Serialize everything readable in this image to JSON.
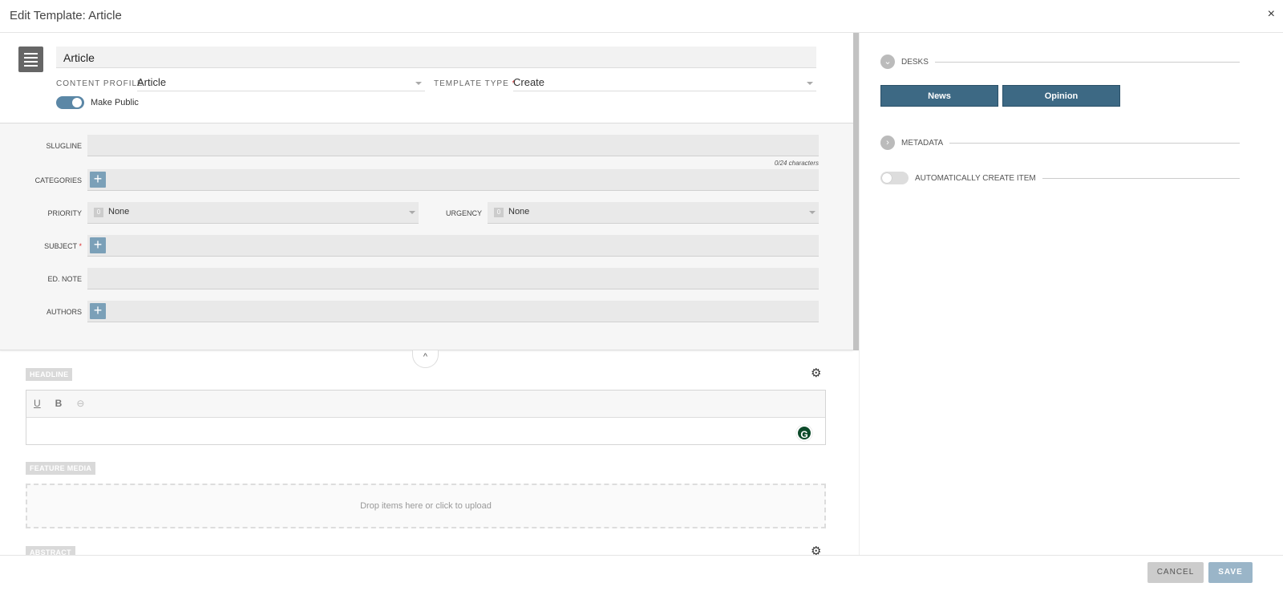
{
  "header": {
    "title": "Edit Template: Article",
    "close": "×"
  },
  "template": {
    "name": "Article",
    "content_profile_label": "CONTENT PROFILE",
    "content_profile": "Article",
    "template_type_label": "TEMPLATE TYPE",
    "required": "*",
    "template_type": "Create",
    "make_public_label": "Make Public",
    "make_public": true
  },
  "metadata": {
    "slugline": "SLUGLINE",
    "slug_count": "0/24  characters",
    "categories": "CATEGORIES",
    "priority": "PRIORITY",
    "priority_badge": "0",
    "priority_value": "None",
    "urgency": "URGENCY",
    "urgency_badge": "0",
    "urgency_value": "None",
    "subject": "SUBJECT",
    "ednote": "ED. NOTE",
    "authors": "AUTHORS"
  },
  "editor": {
    "headline": "HEADLINE",
    "underline": "U",
    "bold": "B",
    "grammarly": "G",
    "feature_media": "FEATURE MEDIA",
    "drop_text": "Drop items here or click to upload",
    "abstract": "ABSTRACT"
  },
  "side": {
    "desks": "DESKS",
    "desk_items": [
      "News",
      "Opinion"
    ],
    "metadata": "METADATA",
    "auto_create": "AUTOMATICALLY CREATE ITEM",
    "auto_create_on": false
  },
  "footer": {
    "cancel": "CANCEL",
    "save": "SAVE"
  },
  "colors": {
    "accent": "#3d6984",
    "toggle": "#5b87a6",
    "save": "#9ab5c8"
  }
}
